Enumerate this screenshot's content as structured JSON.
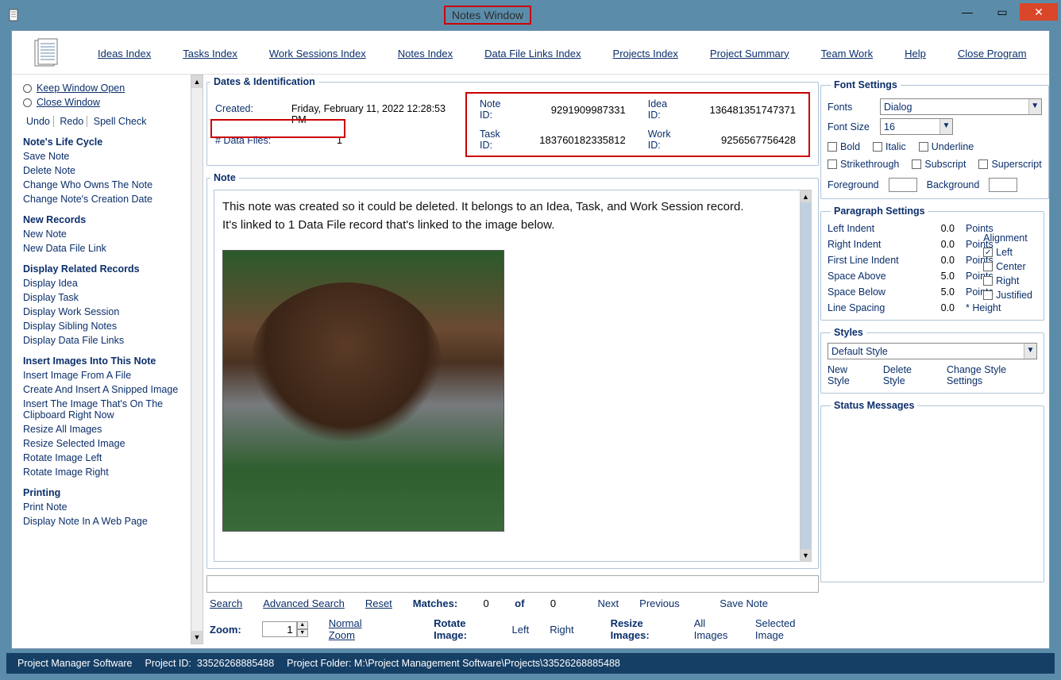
{
  "window": {
    "title": "Notes Window"
  },
  "menubar": {
    "items": [
      "Ideas Index",
      "Tasks Index",
      "Work Sessions Index",
      "Notes Index",
      "Data File Links Index",
      "Projects Index",
      "Project Summary",
      "Team Work",
      "Help",
      "Close Program"
    ]
  },
  "sidebar": {
    "radios": {
      "keep": "Keep Window Open",
      "close": "Close Window"
    },
    "tools": {
      "undo": "Undo",
      "redo": "Redo",
      "spell": "Spell Check"
    },
    "sections": {
      "lifecycle": {
        "heading": "Note's Life Cycle",
        "items": [
          "Save Note",
          "Delete Note",
          "Change Who Owns The Note",
          "Change Note's Creation Date"
        ]
      },
      "newrec": {
        "heading": "New Records",
        "items": [
          "New Note",
          "New Data File Link"
        ]
      },
      "display": {
        "heading": "Display Related Records",
        "items": [
          "Display Idea",
          "Display Task",
          "Display Work Session",
          "Display Sibling Notes",
          "Display Data File Links"
        ]
      },
      "images": {
        "heading": "Insert Images Into This Note",
        "items": [
          "Insert Image From A File",
          "Create And Insert A Snipped Image",
          "Insert The Image That's On The Clipboard Right Now",
          "Resize All Images",
          "Resize Selected Image",
          "Rotate Image Left",
          "Rotate Image Right"
        ]
      },
      "printing": {
        "heading": "Printing",
        "items": [
          "Print Note",
          "Display Note In A Web Page"
        ]
      }
    }
  },
  "dates": {
    "legend": "Dates & Identification",
    "created_label": "Created:",
    "created_value": "Friday, February 11, 2022   12:28:53 PM",
    "datafiles_label": "# Data Files:",
    "datafiles_value": "1",
    "ids": {
      "note_label": "Note ID:",
      "note_value": "9291909987331",
      "idea_label": "Idea ID:",
      "idea_value": "136481351747371",
      "task_label": "Task ID:",
      "task_value": "183760182335812",
      "work_label": "Work ID:",
      "work_value": "9256567756428"
    }
  },
  "note": {
    "legend": "Note",
    "body_line1": "This note was created so it could be deleted. It belongs to an Idea, Task, and Work Session record.",
    "body_line2": "It's linked to 1 Data File record that's linked to the image below."
  },
  "search": {
    "search": "Search",
    "advanced": "Advanced Search",
    "reset": "Reset",
    "matches_label": "Matches:",
    "matches": "0",
    "of": "of",
    "total": "0",
    "next": "Next",
    "prev": "Previous",
    "save": "Save Note"
  },
  "zoom": {
    "zoom_label": "Zoom:",
    "zoom_value": "1",
    "normal": "Normal Zoom",
    "rotate_label": "Rotate Image:",
    "left": "Left",
    "right": "Right",
    "resize_label": "Resize Images:",
    "all": "All Images",
    "selected": "Selected Image"
  },
  "font_settings": {
    "legend": "Font Settings",
    "fonts_label": "Fonts",
    "fonts_value": "Dialog",
    "fontsize_label": "Font Size",
    "fontsize_value": "16",
    "bold": "Bold",
    "italic": "Italic",
    "underline": "Underline",
    "strike": "Strikethrough",
    "sub": "Subscript",
    "sup": "Superscript",
    "fg_label": "Foreground",
    "fg_color": "#000000",
    "bg_label": "Background",
    "bg_color": "#ffffff"
  },
  "para": {
    "legend": "Paragraph Settings",
    "left_indent": "Left Indent",
    "left_indent_v": "0.0",
    "right_indent": "Right Indent",
    "right_indent_v": "0.0",
    "first_line": "First Line Indent",
    "first_line_v": "0.0",
    "space_above": "Space Above",
    "space_above_v": "5.0",
    "space_below": "Space Below",
    "space_below_v": "5.0",
    "line_spacing": "Line Spacing",
    "line_spacing_v": "0.0",
    "points": "Points",
    "height": "* Height",
    "align_label": "Alignment",
    "align": {
      "left": "Left",
      "center": "Center",
      "right": "Right",
      "just": "Justified"
    }
  },
  "styles": {
    "legend": "Styles",
    "selected": "Default Style",
    "new": "New Style",
    "delete": "Delete Style",
    "change": "Change Style Settings"
  },
  "status_panel": {
    "legend": "Status Messages"
  },
  "statusbar": {
    "app": "Project Manager Software",
    "project_id_label": "Project ID:",
    "project_id": "33526268885488",
    "folder_label": "Project Folder:",
    "folder": "M:\\Project Management Software\\Projects\\33526268885488"
  }
}
